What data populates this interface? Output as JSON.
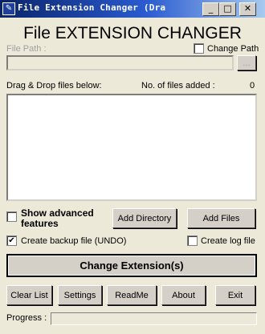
{
  "window": {
    "title": "File Extension Changer (Dra"
  },
  "heading": "File EXTENSION CHANGER",
  "file_path": {
    "label": "File Path :",
    "value": "",
    "browse_label": "..."
  },
  "change_path": {
    "label": "Change Path",
    "checked": false
  },
  "drop": {
    "label": "Drag & Drop files below:",
    "count_label": "No. of files added :",
    "count": "0"
  },
  "advanced": {
    "label_line1": "Show advanced",
    "label_line2": "features",
    "checked": false
  },
  "buttons": {
    "add_directory": "Add Directory",
    "add_files": "Add Files",
    "change_extension": "Change Extension(s)",
    "clear_list": "Clear List",
    "settings": "Settings",
    "readme": "ReadMe",
    "about": "About",
    "exit": "Exit"
  },
  "backup": {
    "label": "Create backup file (UNDO)",
    "checked": true
  },
  "log": {
    "label": "Create log file",
    "checked": false
  },
  "progress": {
    "label": "Progress :",
    "value": 0
  }
}
